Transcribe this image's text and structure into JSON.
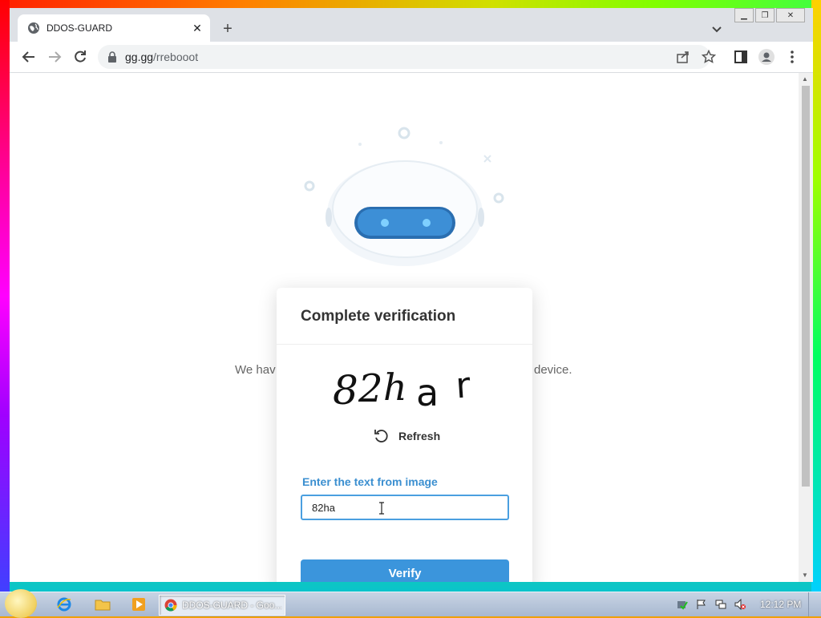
{
  "browser": {
    "tab_title": "DDOS-GUARD",
    "url_host": "gg.gg",
    "url_path": "/rrebooot"
  },
  "page": {
    "background_text_left": "We hav",
    "background_text_right": "device."
  },
  "card": {
    "title": "Complete verification",
    "captcha_text": "82har",
    "refresh_label": "Refresh",
    "input_label": "Enter the text from image",
    "input_value": "82ha",
    "verify_label": "Verify"
  },
  "taskbar": {
    "task_label": "DDOS-GUARD - Goo...",
    "clock": "12:12 PM"
  },
  "colors": {
    "accent": "#3b95dc",
    "label_blue": "#3b8fd0"
  }
}
